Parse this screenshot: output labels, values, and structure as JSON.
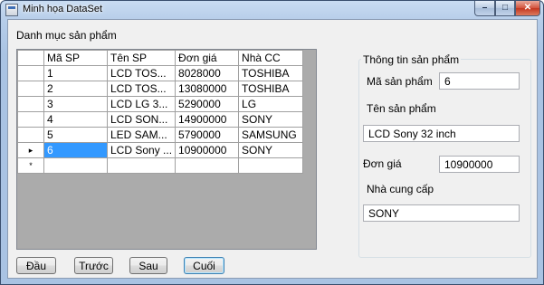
{
  "window": {
    "title": "Minh họa DataSet",
    "minimize_glyph": "–",
    "maximize_glyph": "□",
    "close_glyph": "✕"
  },
  "heading": "Danh mục sản phẩm",
  "grid": {
    "columns": [
      "Mã SP",
      "Tên SP",
      "Đơn giá",
      "Nhà CC"
    ],
    "rows": [
      {
        "id": "1",
        "name": "LCD TOS...",
        "price": "8028000",
        "supplier": "TOSHIBA",
        "marker": ""
      },
      {
        "id": "2",
        "name": "LCD TOS...",
        "price": "13080000",
        "supplier": "TOSHIBA",
        "marker": ""
      },
      {
        "id": "3",
        "name": "LCD LG 3...",
        "price": "5290000",
        "supplier": "LG",
        "marker": ""
      },
      {
        "id": "4",
        "name": "LCD SON...",
        "price": "14900000",
        "supplier": "SONY",
        "marker": ""
      },
      {
        "id": "5",
        "name": "LED SAM...",
        "price": "5790000",
        "supplier": "SAMSUNG",
        "marker": ""
      },
      {
        "id": "6",
        "name": "LCD Sony ...",
        "price": "10900000",
        "supplier": "SONY",
        "marker": "▸"
      }
    ],
    "new_row_marker": "*",
    "selected_row": 5
  },
  "details": {
    "group_title": "Thông tin sản phẩm",
    "id_label": "Mã sản phẩm",
    "id_value": "6",
    "name_label": "Tên sản phẩm",
    "name_value": "LCD Sony 32 inch",
    "price_label": "Đơn giá",
    "price_value": "10900000",
    "supplier_label": "Nhà cung cấp",
    "supplier_value": "SONY"
  },
  "nav": {
    "first": "Đầu",
    "prev": "Trước",
    "next": "Sau",
    "last": "Cuối"
  }
}
